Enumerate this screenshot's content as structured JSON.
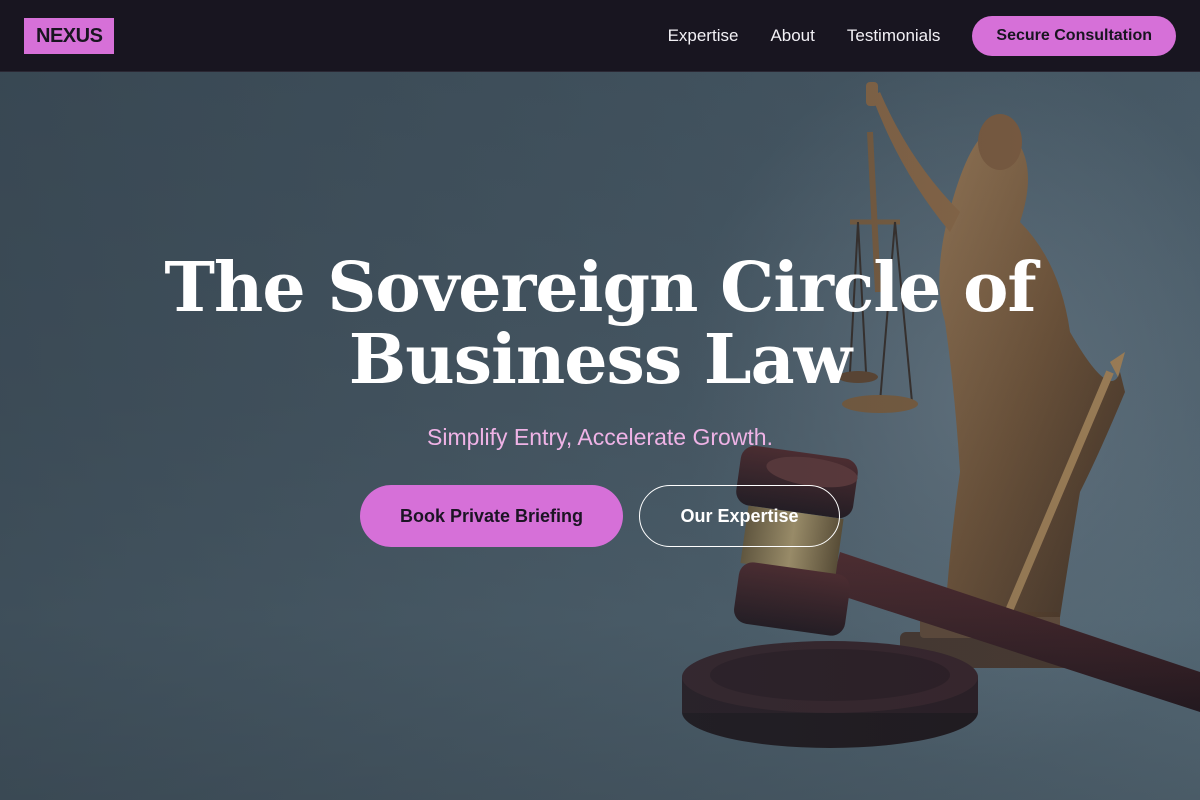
{
  "header": {
    "logo": "NEXUS",
    "nav": [
      {
        "label": "Expertise"
      },
      {
        "label": "About"
      },
      {
        "label": "Testimonials"
      }
    ],
    "cta_label": "Secure Consultation"
  },
  "hero": {
    "headline_line1": "The Sovereign Circle of",
    "headline_line2": "Business Law",
    "subheadline": "Simplify Entry, Accelerate Growth.",
    "primary_button": "Book Private Briefing",
    "secondary_button": "Our Expertise",
    "background_image": "lady-justice-statue-and-gavel"
  },
  "colors": {
    "accent": "#d670d8",
    "nav_bg": "#181520",
    "subheadline": "#efb3e6",
    "text_light": "#ffffff"
  }
}
